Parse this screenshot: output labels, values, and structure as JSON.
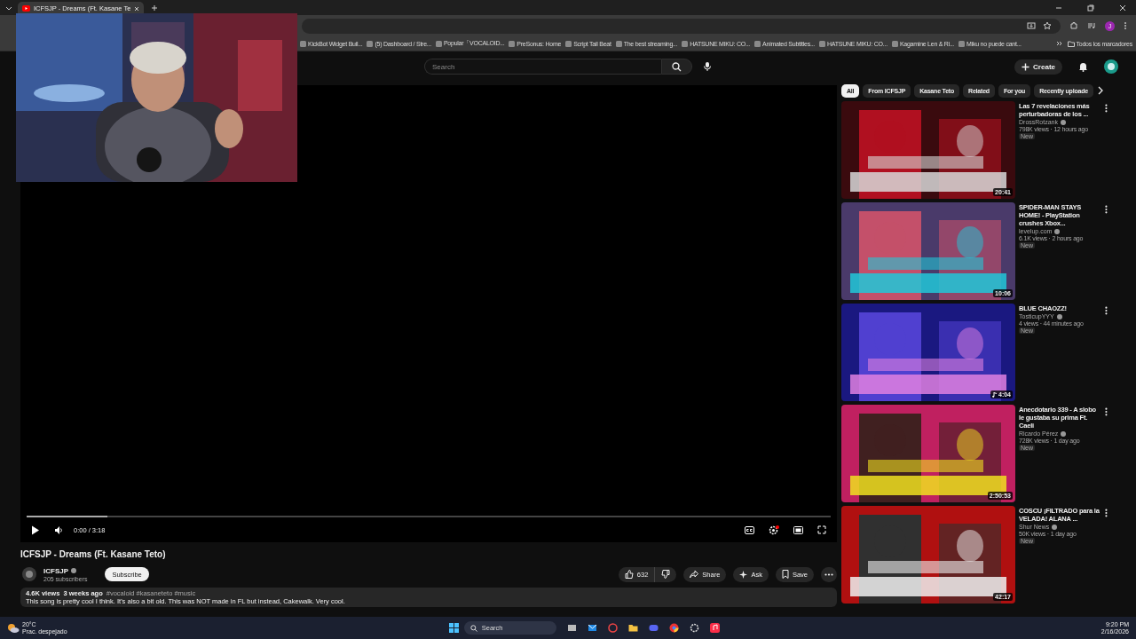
{
  "browser": {
    "tabs": [
      {
        "title": "ICFSJP - Dreams (Ft. Kasane Te",
        "selected": true
      }
    ],
    "bookmarks": [
      {
        "label": "KickBot Widget Buil..."
      },
      {
        "label": "(5) Dashboard / Stre..."
      },
      {
        "label": "Popular「VOCALOID..."
      },
      {
        "label": "PreSonus: Home"
      },
      {
        "label": "Script Tail Beat"
      },
      {
        "label": "The best streaming..."
      },
      {
        "label": "HATSUNE MIKU: CO..."
      },
      {
        "label": "Animated Subtitles..."
      },
      {
        "label": "HATSUNE MIKU: CO..."
      },
      {
        "label": "Kagamine Len & Ri..."
      },
      {
        "label": "Miku no puede cant..."
      }
    ],
    "all_bookmarks": "Todos los marcadores",
    "profile_initial": "J"
  },
  "youtube": {
    "search": {
      "placeholder": "Search"
    },
    "create": "Create",
    "player": {
      "progress": {
        "level": 0.1
      },
      "time": "0:00 / 3:18"
    },
    "video": {
      "title": "ICFSJP - Dreams (Ft. Kasane Teto)",
      "channel": "ICFSJP",
      "subscribers": "205 subscribers",
      "subscribe": "Subscribe",
      "likes": "632",
      "share": "Share",
      "ask": "Ask",
      "save": "Save",
      "stats": "4.6K views  3 weeks ago",
      "hashtags": "#vocaloid #kasaneteto #music",
      "description": "This song is pretty cool I think. It's also a bit old. This was NOT made in FL but instead, Cakewalk. Very cool."
    },
    "chips": [
      {
        "label": "All",
        "selected": true
      },
      {
        "label": "From ICFSJP",
        "selected": false
      },
      {
        "label": "Kasane Teto",
        "selected": false
      },
      {
        "label": "Related",
        "selected": false
      },
      {
        "label": "For you",
        "selected": false
      },
      {
        "label": "Recently uploade",
        "selected": false
      }
    ],
    "recommended": [
      {
        "title": "Las 7 revelaciones más perturbadoras de los ...",
        "channel": "DrossRotzank",
        "meta": "798K views · 12 hours ago",
        "badge": "New",
        "duration": "20:41",
        "kind": "video"
      },
      {
        "title": "SPIDER-MAN STAYS HOME! - PlayStation crushes Xbox...",
        "channel": "levelup.com",
        "meta": "6.1K views · 2 hours ago",
        "badge": "New",
        "duration": "10:06",
        "kind": "video"
      },
      {
        "title": "BLUE CHAOZZ!",
        "channel": "TosticupYYY",
        "meta": "4 views · 44 minutes ago",
        "badge": "New",
        "duration": "4:04",
        "kind": "music"
      },
      {
        "title": "Anecdotario 339 - A slobo le gustaba su prima Ft. Caeli",
        "channel": "Ricardo Pérez",
        "meta": "728K views · 1 day ago",
        "badge": "New",
        "duration": "2:50:53",
        "kind": "video"
      },
      {
        "title": "COSCU ¡FILTRADO para la VELADA! ALANA ...",
        "channel": "Shur News",
        "meta": "50K views · 1 day ago",
        "badge": "New",
        "duration": "42:17",
        "kind": "video"
      }
    ]
  },
  "taskbar": {
    "weather": {
      "temp": "20°C",
      "condition": "Prac. despejado"
    },
    "search": "Search",
    "time": "9:20 PM",
    "date": "2/16/2026"
  }
}
